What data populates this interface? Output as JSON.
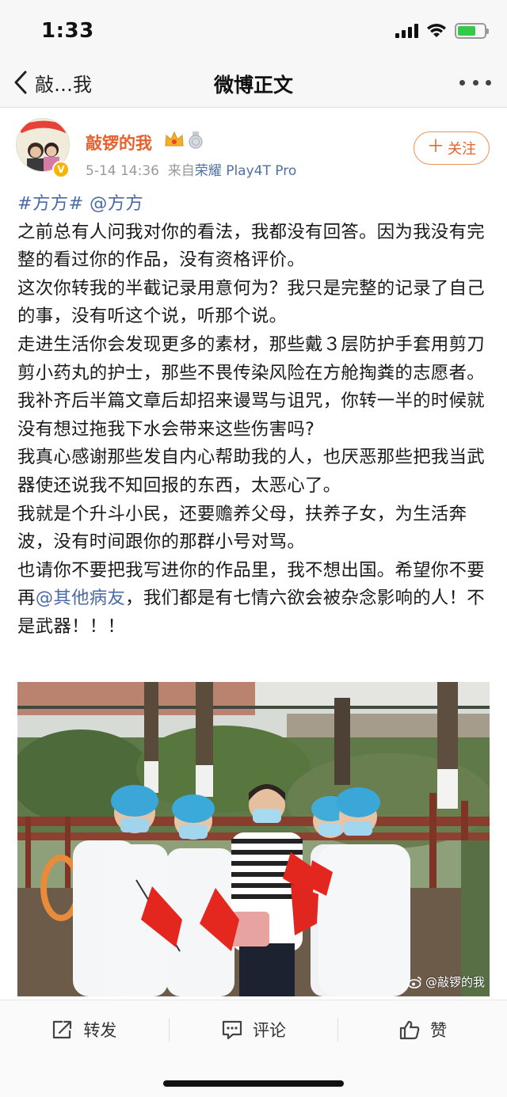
{
  "status_bar": {
    "time": "1:33",
    "battery_level": 0.7,
    "battery_color": "#36c84a"
  },
  "nav": {
    "back_label": "敲…我",
    "title": "微博正文"
  },
  "author": {
    "name": "敲锣的我",
    "verified_color": "#f7b400",
    "name_color": "#e8612b",
    "avatar_banner_text": "武汉加油!"
  },
  "meta": {
    "date": "5-14 14:36",
    "source_prefix": "来自",
    "device": "荣耀 Play4T Pro"
  },
  "follow": {
    "plus": "＋",
    "label": "关注"
  },
  "post": {
    "tag": "#方方#",
    "mention": "@方方",
    "paragraphs": [
      "之前总有人问我对你的看法，我都没有回答。因为我没有完整的看过你的作品，没有资格评价。",
      "这次你转我的半截记录用意何为？我只是完整的记录了自己的事，没有听这个说，听那个说。",
      "走进生活你会发现更多的素材，那些戴３层防护手套用剪刀剪小药丸的护士，那些不畏传染风险在方舱掏粪的志愿者。",
      "我补齐后半篇文章后却招来谩骂与诅咒，你转一半的时候就没有想过拖我下水会带来这些伤害吗?",
      "我真心感谢那些发自内心帮助我的人，也厌恶那些把我当武器使还说我不知回报的东西，太恶心了。",
      "我就是个升斗小民，还要赡养父母，扶养子女，为生活奔波，没有时间跟你的那群小号对骂。"
    ],
    "last_para_before": "也请你不要把我写进你的作品里，我不想出国。希望你不要再",
    "last_para_mention": "@其他病友",
    "last_para_after": "，我们都是有七情六欲会被杂念影响的人！不是武器！！！"
  },
  "photo": {
    "watermark": "@敲锣的我"
  },
  "actions": {
    "repost": "转发",
    "comment": "评论",
    "like": "赞"
  }
}
